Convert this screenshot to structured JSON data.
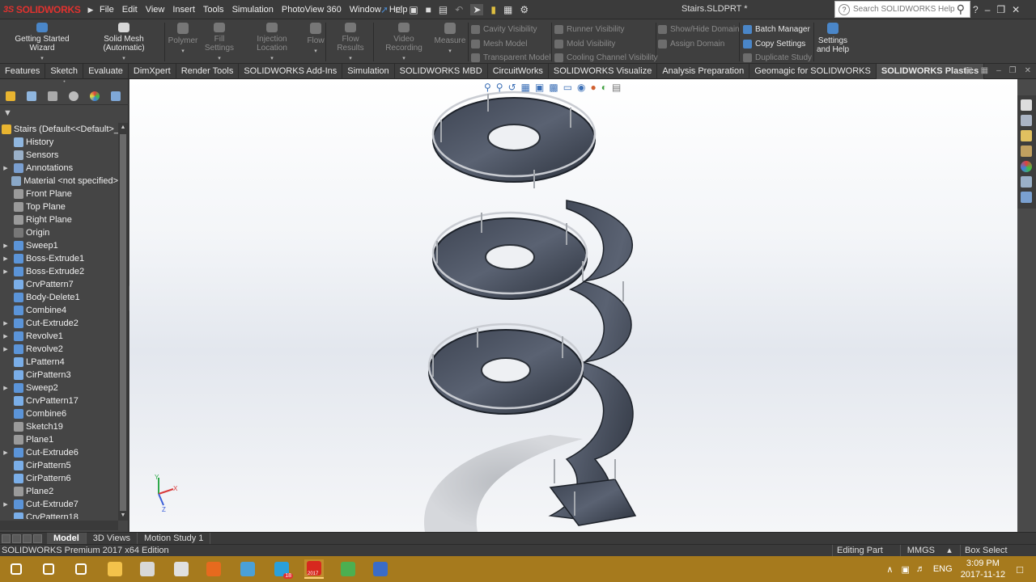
{
  "titlebar": {
    "logo_ds": "3S",
    "logo_text": "SOLIDWORKS",
    "menus": [
      "File",
      "Edit",
      "View",
      "Insert",
      "Tools",
      "Simulation",
      "PhotoView 360",
      "Window",
      "Help"
    ],
    "doc_title": "Stairs.SLDPRT *",
    "search_placeholder": "Search SOLIDWORKS Help"
  },
  "command_manager": {
    "big_buttons": [
      {
        "label": "Getting Started Wizard",
        "enabled": true,
        "color": "#4a86c8"
      },
      {
        "label": "Solid Mesh (Automatic)",
        "enabled": true,
        "color": "#d8d8d8"
      },
      {
        "label": "Polymer",
        "enabled": false,
        "color": "#777777"
      },
      {
        "label": "Fill Settings",
        "enabled": false,
        "color": "#777777"
      },
      {
        "label": "Injection Location",
        "enabled": false,
        "color": "#777777"
      },
      {
        "label": "Flow",
        "enabled": false,
        "color": "#777777"
      },
      {
        "label": "Flow Results",
        "enabled": false,
        "color": "#777777"
      },
      {
        "label": "Video Recording",
        "enabled": false,
        "color": "#777777"
      },
      {
        "label": "Measure",
        "enabled": false,
        "color": "#777777"
      }
    ],
    "small_buttons": [
      {
        "label": "Cavity Visibility",
        "enabled": false
      },
      {
        "label": "Mesh Model",
        "enabled": false
      },
      {
        "label": "Transparent Model",
        "enabled": false
      },
      {
        "label": "Runner Visibility",
        "enabled": false
      },
      {
        "label": "Mold Visibility",
        "enabled": false
      },
      {
        "label": "Cooling Channel Visibility",
        "enabled": false
      },
      {
        "label": "Show/Hide Domain",
        "enabled": false
      },
      {
        "label": "Assign Domain",
        "enabled": false
      },
      {
        "label": "Batch Manager",
        "enabled": true
      },
      {
        "label": "Copy Settings",
        "enabled": true
      },
      {
        "label": "Duplicate Study",
        "enabled": false
      }
    ],
    "settings_help_1": "Settings",
    "settings_help_2": "and Help"
  },
  "tabs": [
    "Features",
    "Sketch",
    "Evaluate",
    "DimXpert",
    "Render Tools",
    "SOLIDWORKS Add-Ins",
    "Simulation",
    "SOLIDWORKS MBD",
    "CircuitWorks",
    "SOLIDWORKS Visualize",
    "Analysis Preparation",
    "Geomagic for SOLIDWORKS",
    "SOLIDWORKS Plastics"
  ],
  "active_tab": "SOLIDWORKS Plastics",
  "feature_tree": [
    {
      "label": "Stairs  (Default<<Default>_D",
      "expandable": false,
      "icon": "part-icon",
      "color": "#e8b430"
    },
    {
      "label": "History",
      "expandable": false,
      "icon": "history-icon",
      "color": "#8fb6df"
    },
    {
      "label": "Sensors",
      "expandable": false,
      "icon": "sensor-icon",
      "color": "#9ab0c8"
    },
    {
      "label": "Annotations",
      "expandable": true,
      "icon": "annotation-icon",
      "color": "#7a9fd0"
    },
    {
      "label": "Material <not specified>",
      "expandable": false,
      "icon": "material-icon",
      "color": "#8aa8c8"
    },
    {
      "label": "Front Plane",
      "expandable": false,
      "icon": "plane-icon",
      "color": "#9a9a9a"
    },
    {
      "label": "Top Plane",
      "expandable": false,
      "icon": "plane-icon",
      "color": "#9a9a9a"
    },
    {
      "label": "Right Plane",
      "expandable": false,
      "icon": "plane-icon",
      "color": "#9a9a9a"
    },
    {
      "label": "Origin",
      "expandable": false,
      "icon": "origin-icon",
      "color": "#777777"
    },
    {
      "label": "Sweep1",
      "expandable": true,
      "icon": "sweep-icon",
      "color": "#5b94d8"
    },
    {
      "label": "Boss-Extrude1",
      "expandable": true,
      "icon": "extrude-icon",
      "color": "#5b94d8"
    },
    {
      "label": "Boss-Extrude2",
      "expandable": true,
      "icon": "extrude-icon",
      "color": "#5b94d8"
    },
    {
      "label": "CrvPattern7",
      "expandable": false,
      "icon": "pattern-icon",
      "color": "#7aaee8"
    },
    {
      "label": "Body-Delete1",
      "expandable": false,
      "icon": "body-delete-icon",
      "color": "#5b94d8"
    },
    {
      "label": "Combine4",
      "expandable": false,
      "icon": "combine-icon",
      "color": "#5b94d8"
    },
    {
      "label": "Cut-Extrude2",
      "expandable": true,
      "icon": "cut-icon",
      "color": "#5b94d8"
    },
    {
      "label": "Revolve1",
      "expandable": true,
      "icon": "revolve-icon",
      "color": "#5b94d8"
    },
    {
      "label": "Revolve2",
      "expandable": true,
      "icon": "revolve-icon",
      "color": "#5b94d8"
    },
    {
      "label": "LPattern4",
      "expandable": false,
      "icon": "pattern-icon",
      "color": "#7aaee8"
    },
    {
      "label": "CirPattern3",
      "expandable": false,
      "icon": "pattern-icon",
      "color": "#7aaee8"
    },
    {
      "label": "Sweep2",
      "expandable": true,
      "icon": "sweep-icon",
      "color": "#5b94d8"
    },
    {
      "label": "CrvPattern17",
      "expandable": false,
      "icon": "pattern-icon",
      "color": "#7aaee8"
    },
    {
      "label": "Combine6",
      "expandable": false,
      "icon": "combine-icon",
      "color": "#5b94d8"
    },
    {
      "label": "Sketch19",
      "expandable": false,
      "icon": "sketch-icon",
      "color": "#9a9a9a"
    },
    {
      "label": "Plane1",
      "expandable": false,
      "icon": "plane-icon",
      "color": "#9a9a9a"
    },
    {
      "label": "Cut-Extrude6",
      "expandable": true,
      "icon": "cut-icon",
      "color": "#5b94d8"
    },
    {
      "label": "CirPattern5",
      "expandable": false,
      "icon": "pattern-icon",
      "color": "#7aaee8"
    },
    {
      "label": "CirPattern6",
      "expandable": false,
      "icon": "pattern-icon",
      "color": "#7aaee8"
    },
    {
      "label": "Plane2",
      "expandable": false,
      "icon": "plane-icon",
      "color": "#9a9a9a"
    },
    {
      "label": "Cut-Extrude7",
      "expandable": true,
      "icon": "cut-icon",
      "color": "#5b94d8"
    },
    {
      "label": "CrvPattern18",
      "expandable": false,
      "icon": "pattern-icon",
      "color": "#7aaee8"
    }
  ],
  "bottom_tabs": [
    "Model",
    "3D Views",
    "Motion Study 1"
  ],
  "active_bottom_tab": "Model",
  "status": {
    "edition": "SOLIDWORKS Premium 2017 x64 Edition",
    "mode": "Editing Part",
    "units": "MMGS",
    "units_caret": "▴",
    "selection": "Box Select"
  },
  "triad": {
    "x_label": "X",
    "y_label": "Y",
    "z_label": "Z"
  },
  "taskbar": {
    "apps": [
      {
        "name": "start-icon",
        "color": "#ffffff"
      },
      {
        "name": "search-icon",
        "color": "#ffffff"
      },
      {
        "name": "task-view-icon",
        "color": "#ffffff"
      },
      {
        "name": "file-explorer-icon",
        "color": "#f3c24b"
      },
      {
        "name": "app-icon",
        "color": "#d8d8d8"
      },
      {
        "name": "calculator-icon",
        "color": "#e0e0e0"
      },
      {
        "name": "firefox-icon",
        "color": "#e66a1e"
      },
      {
        "name": "photos-icon",
        "color": "#4aa0d8"
      },
      {
        "name": "telegram-icon",
        "color": "#2aa0da"
      },
      {
        "name": "solidworks-icon",
        "color": "#d7281e"
      },
      {
        "name": "globe-icon",
        "color": "#4caf50"
      },
      {
        "name": "flag-icon",
        "color": "#3a6cc8"
      }
    ],
    "telegram_badge": "18",
    "solidworks_badge": "2017",
    "language": "ENG",
    "tray_caret": "∧",
    "time": "3:09 PM",
    "date": "2017-11-12"
  }
}
